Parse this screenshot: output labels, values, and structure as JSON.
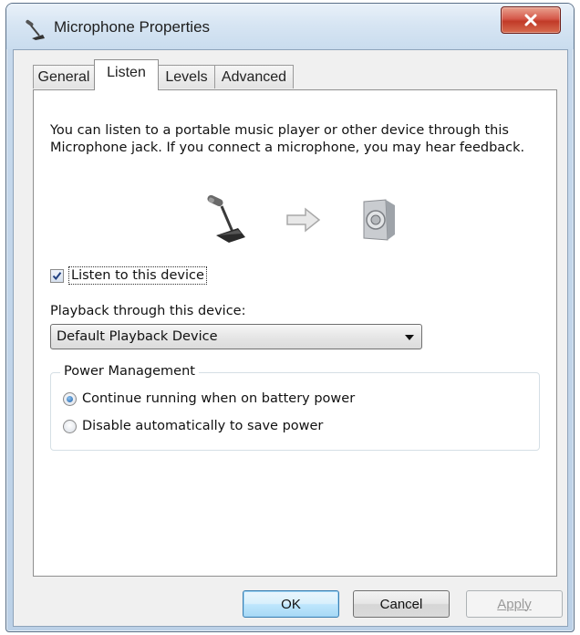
{
  "window": {
    "title": "Microphone Properties",
    "title_icon": "microphone-icon",
    "close_icon": "close-icon"
  },
  "tabs": [
    {
      "label": "General",
      "active": false
    },
    {
      "label": "Listen",
      "active": true
    },
    {
      "label": "Levels",
      "active": false
    },
    {
      "label": "Advanced",
      "active": false
    }
  ],
  "listen": {
    "description": "You can listen to a portable music player or other device through this Microphone jack.  If you connect a microphone, you may hear feedback.",
    "illustration": {
      "source_icon": "microphone-icon",
      "arrow_icon": "arrow-right-icon",
      "target_icon": "speaker-icon"
    },
    "listen_checkbox": {
      "label": "Listen to this device",
      "checked": true
    },
    "playback_label": "Playback through this device:",
    "playback_select": {
      "value": "Default Playback Device"
    },
    "power_management": {
      "legend": "Power Management",
      "options": [
        {
          "label": "Continue running when on battery power",
          "selected": true
        },
        {
          "label": "Disable automatically to save power",
          "selected": false
        }
      ]
    }
  },
  "buttons": {
    "ok": "OK",
    "cancel": "Cancel",
    "apply_first": "A",
    "apply_rest": "pply",
    "apply_enabled": false
  },
  "colors": {
    "accent": "#3c7fb1",
    "close": "#c13a28",
    "frame": "#bcd1e7"
  }
}
